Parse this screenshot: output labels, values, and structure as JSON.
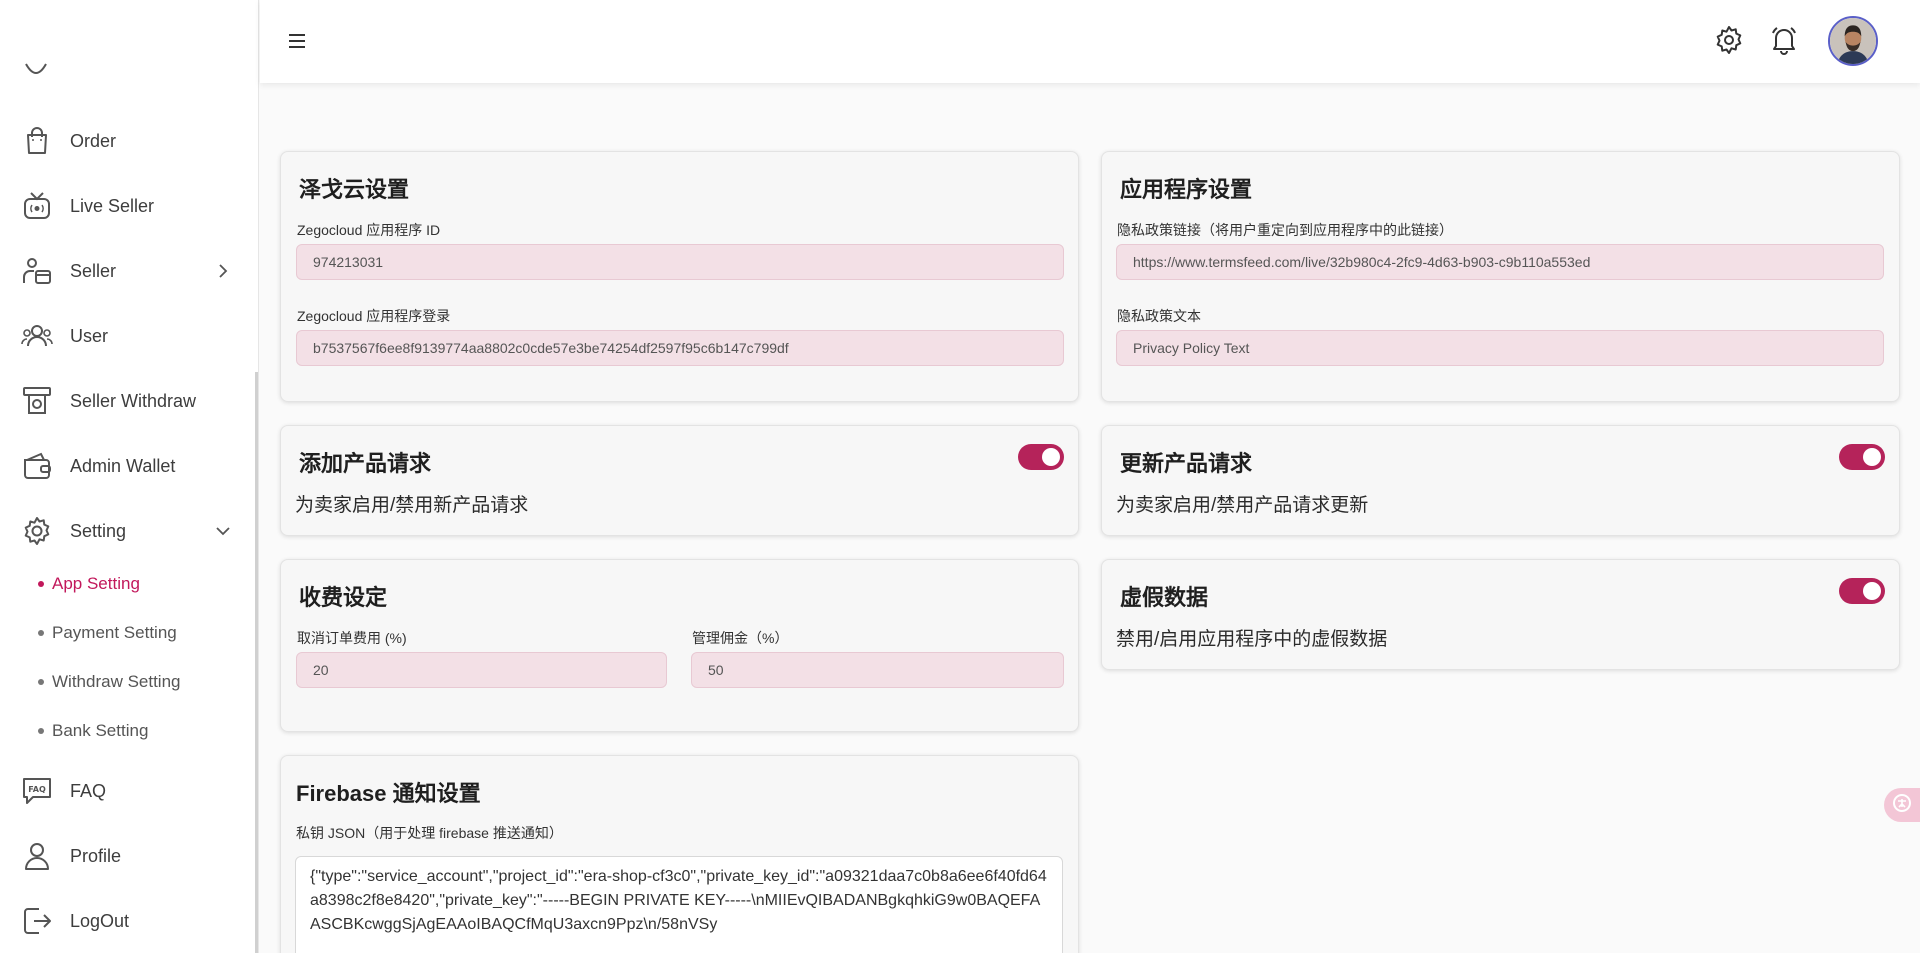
{
  "sidebar": {
    "items": [
      {
        "label": "Order",
        "icon": "bag-icon"
      },
      {
        "label": "Live Seller",
        "icon": "tv-icon"
      },
      {
        "label": "Seller",
        "icon": "seller-icon"
      },
      {
        "label": "User",
        "icon": "users-icon"
      },
      {
        "label": "Seller Withdraw",
        "icon": "withdraw-icon"
      },
      {
        "label": "Admin Wallet",
        "icon": "wallet-icon"
      },
      {
        "label": "Setting",
        "icon": "gear-icon"
      },
      {
        "label": "FAQ",
        "icon": "faq-icon"
      },
      {
        "label": "Profile",
        "icon": "person-icon"
      },
      {
        "label": "LogOut",
        "icon": "logout-icon"
      }
    ],
    "sub_items": [
      {
        "label": "App Setting",
        "active": true
      },
      {
        "label": "Payment Setting",
        "active": false
      },
      {
        "label": "Withdraw Setting",
        "active": false
      },
      {
        "label": "Bank Setting",
        "active": false
      }
    ]
  },
  "topbar": {
    "icons": [
      "menu-icon",
      "gear-icon",
      "bell-icon"
    ]
  },
  "zego": {
    "title": "泽戈云设置",
    "app_id_label": "Zegocloud 应用程序 ID",
    "app_id_value": "974213031",
    "app_sign_label": "Zegocloud 应用程序登录",
    "app_sign_value": "b7537567f6ee8f9139774aa8802c0cde57e3be74254df2597f95c6b147c799df"
  },
  "app_setting": {
    "title": "应用程序设置",
    "privacy_link_label": "隐私政策链接（将用户重定向到应用程序中的此链接）",
    "privacy_link_value": "https://www.termsfeed.com/live/32b980c4-2fc9-4d63-b903-c9b110a553ed",
    "privacy_text_label": "隐私政策文本",
    "privacy_text_value": "Privacy Policy Text"
  },
  "add_product_request": {
    "title": "添加产品请求",
    "description": "为卖家启用/禁用新产品请求",
    "enabled": true
  },
  "update_product_request": {
    "title": "更新产品请求",
    "description": "为卖家启用/禁用产品请求更新",
    "enabled": true
  },
  "charges": {
    "title": "收费设定",
    "cancel_fee_label": "取消订单费用 (%)",
    "cancel_fee_value": "20",
    "admin_commission_label": "管理佣金（%）",
    "admin_commission_value": "50"
  },
  "fake_data": {
    "title": "虚假数据",
    "description": "禁用/启用应用程序中的虚假数据",
    "enabled": true
  },
  "firebase": {
    "title": "Firebase 通知设置",
    "private_key_label": "私钥 JSON（用于处理 firebase 推送通知）",
    "private_key_value": "{\"type\":\"service_account\",\"project_id\":\"era-shop-cf3c0\",\"private_key_id\":\"a09321daa7c0b8a6ee6f40fd64a8398c2f8e8420\",\"private_key\":\"-----BEGIN PRIVATE KEY-----\\nMIIEvQIBADANBgkqhkiG9w0BAQEFAASCBKcwggSjAgEAAoIBAQCfMqU3axcn9Ppz\\n/58nVSy"
  },
  "colors": {
    "accent": "#c2185b",
    "toggle_on": "#b5235a",
    "field_bg": "#f3e0e6"
  }
}
